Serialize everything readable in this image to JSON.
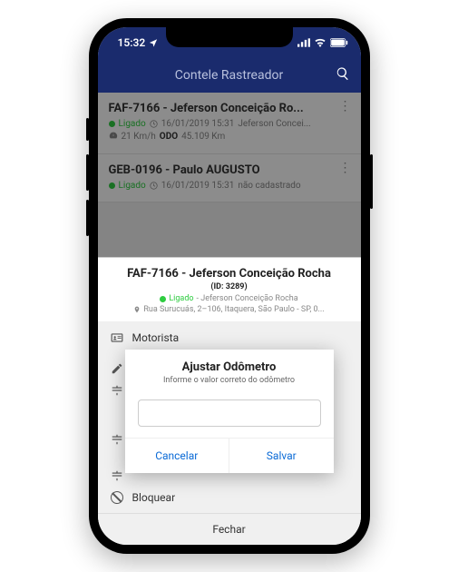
{
  "status": {
    "time": "15:32"
  },
  "header": {
    "title": "Contele Rastreador"
  },
  "vehicles": [
    {
      "title": "FAF-7166 - Jeferson Conceição Ro...",
      "state": "Ligado",
      "timestamp": "16/01/2019 15:31",
      "driver": "Jeferson Concei...",
      "speed": "21 Km/h",
      "odo_label": "ODO",
      "odo_value": "45.109 Km"
    },
    {
      "title": "GEB-0196 - Paulo AUGUSTO",
      "state": "Ligado",
      "timestamp": "16/01/2019 15:31",
      "driver": "não cadastrado"
    }
  ],
  "sheet": {
    "title": "FAF-7166 - Jeferson Conceição Rocha",
    "id_label": "(ID: 3289)",
    "state": "Ligado",
    "driver": "- Jeferson Conceição Rocha",
    "address": "Rua Surucuás, 2–106, Itaquera, São Paulo - SP, 0...",
    "menu": {
      "driver": "Motorista",
      "adjust": "Ajustar odômetro",
      "block": "Bloquear"
    },
    "close": "Fechar"
  },
  "dialog": {
    "title": "Ajustar Odômetro",
    "subtitle": "Informe o valor correto do odômetro",
    "input_value": "",
    "cancel": "Cancelar",
    "save": "Salvar"
  }
}
